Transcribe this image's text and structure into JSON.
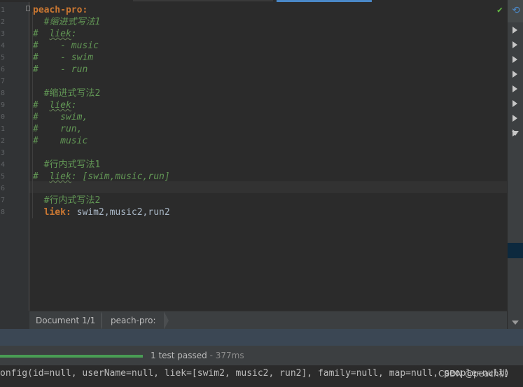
{
  "editor": {
    "line_numbers": [
      "1",
      "2",
      "3",
      "4",
      "5",
      "6",
      "7",
      "8",
      "9",
      "0",
      "1",
      "2",
      "3",
      "4",
      "5",
      "6",
      "7",
      "8"
    ],
    "lines": [
      [
        {
          "t": "peach-pro:",
          "c": "key"
        }
      ],
      [
        {
          "t": "  ",
          "c": "val"
        },
        {
          "t": "#缩进式写法1",
          "c": "comment"
        }
      ],
      [
        {
          "t": "#  ",
          "c": "comment"
        },
        {
          "t": "liek",
          "c": "comment squig"
        },
        {
          "t": ":",
          "c": "comment"
        }
      ],
      [
        {
          "t": "#    - music",
          "c": "comment"
        }
      ],
      [
        {
          "t": "#    - swim",
          "c": "comment"
        }
      ],
      [
        {
          "t": "#    - run",
          "c": "comment"
        }
      ],
      [],
      [
        {
          "t": "  ",
          "c": "val"
        },
        {
          "t": "#缩进式写法2",
          "c": "comment2"
        }
      ],
      [
        {
          "t": "#  ",
          "c": "comment"
        },
        {
          "t": "liek",
          "c": "comment squig"
        },
        {
          "t": ":",
          "c": "comment"
        }
      ],
      [
        {
          "t": "#    swim,",
          "c": "comment"
        }
      ],
      [
        {
          "t": "#    run,",
          "c": "comment"
        }
      ],
      [
        {
          "t": "#    music",
          "c": "comment"
        }
      ],
      [],
      [
        {
          "t": "  ",
          "c": "val"
        },
        {
          "t": "#行内式写法1",
          "c": "comment2"
        }
      ],
      [
        {
          "t": "#  ",
          "c": "comment"
        },
        {
          "t": "liek",
          "c": "comment squig"
        },
        {
          "t": ": [swim,music,run]",
          "c": "comment"
        }
      ],
      [],
      [
        {
          "t": "  ",
          "c": "val"
        },
        {
          "t": "#行内式写法2",
          "c": "comment2"
        }
      ],
      [
        {
          "t": "  ",
          "c": "val"
        },
        {
          "t": "liek:",
          "c": "key"
        },
        {
          "t": " swim2,music2,run2",
          "c": "val"
        }
      ]
    ]
  },
  "inspection_icon": "check-icon",
  "right_panel": {
    "refresh_icon": "refresh-icon",
    "expand_arrows": 8
  },
  "breadcrumb": {
    "items": [
      "Document 1/1",
      "peach-pro:"
    ]
  },
  "tests": {
    "status": "1 test passed",
    "separator": " - ",
    "time": "377ms",
    "progress": 1.0,
    "color": "#499c54"
  },
  "console": {
    "output": "onfig(id=null, userName=null, liek=[swim2, music2, run2], family=null, map=null, people=null)"
  },
  "watermark": "CSDN @peach桃"
}
